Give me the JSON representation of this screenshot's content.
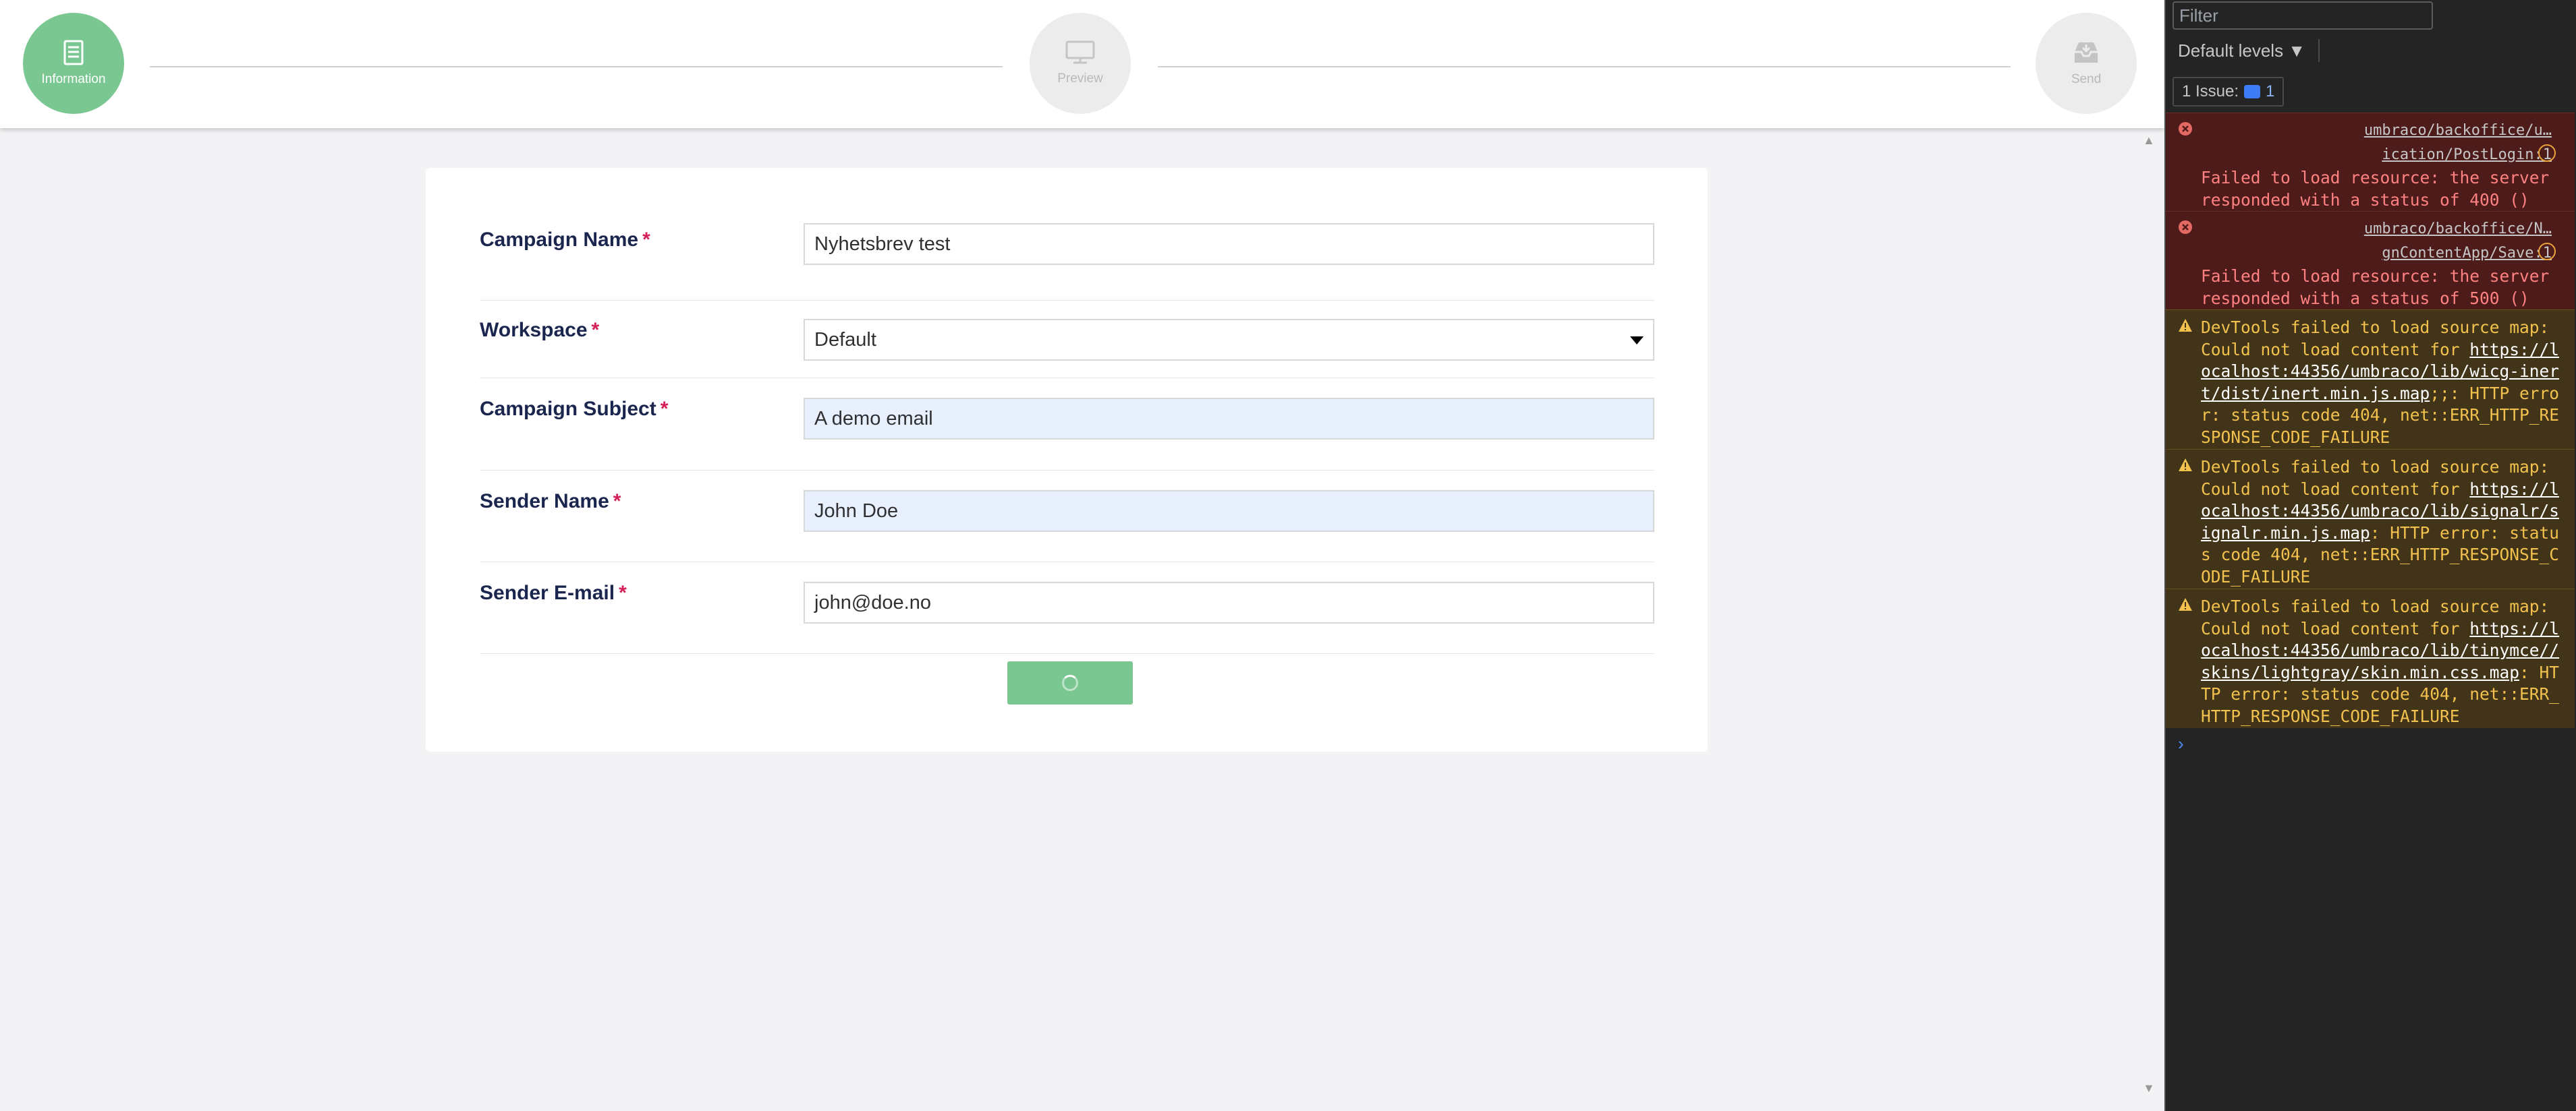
{
  "stepper": {
    "steps": [
      {
        "label": "Information",
        "icon": "document-icon",
        "active": true
      },
      {
        "label": "Preview",
        "icon": "monitor-icon",
        "active": false
      },
      {
        "label": "Send",
        "icon": "inbox-icon",
        "active": false
      }
    ]
  },
  "form": {
    "fields": [
      {
        "label": "Campaign Name",
        "required": "*",
        "value": "Nyhetsbrev test",
        "type": "text"
      },
      {
        "label": "Workspace",
        "required": "*",
        "value": "Default",
        "type": "select"
      },
      {
        "label": "Campaign Subject",
        "required": "*",
        "value": "A demo email",
        "type": "text"
      },
      {
        "label": "Sender Name",
        "required": "*",
        "value": "John Doe",
        "type": "text"
      },
      {
        "label": "Sender E-mail",
        "required": "*",
        "value": "john@doe.no",
        "type": "text"
      }
    ],
    "submit_state": "loading"
  },
  "colors": {
    "accent": "#7bc792",
    "required": "#d42054",
    "autofill": "#e8f0fe"
  },
  "devtools": {
    "filter_placeholder": "Filter",
    "levels": "Default levels ▼",
    "issues_label": "1 Issue:",
    "issues_count": "1",
    "messages": [
      {
        "level": "error",
        "link": "umbraco/backoffice/u…ication/PostLogin:1",
        "text": "Failed to load resource: the server responded with a status of 400 ()"
      },
      {
        "level": "error",
        "link": "umbraco/backoffice/N…gnContentApp/Save:1",
        "text": "Failed to load resource: the server responded with a status of 500 ()"
      },
      {
        "level": "warning",
        "text_before": "DevTools failed to load source map: Could not load content for ",
        "url": "https://localhost:44356/umbraco/lib/wicg-inert/dist/inert.min.js.map",
        "text_after": ";;: HTTP error: status code 404, net::ERR_HTTP_RESPONSE_CODE_FAILURE"
      },
      {
        "level": "warning",
        "text_before": "DevTools failed to load source map: Could not load content for ",
        "url": "https://localhost:44356/umbraco/lib/signalr/signalr.min.js.map",
        "text_after": ": HTTP error: status code 404, net::ERR_HTTP_RESPONSE_CODE_FAILURE"
      },
      {
        "level": "warning",
        "text_before": "DevTools failed to load source map: Could not load content for ",
        "url": "https://localhost:44356/umbraco/lib/tinymce//skins/lightgray/skin.min.css.map",
        "text_after": ": HTTP error: status code 404, net::ERR_HTTP_RESPONSE_CODE_FAILURE"
      }
    ],
    "prompt": "›"
  }
}
